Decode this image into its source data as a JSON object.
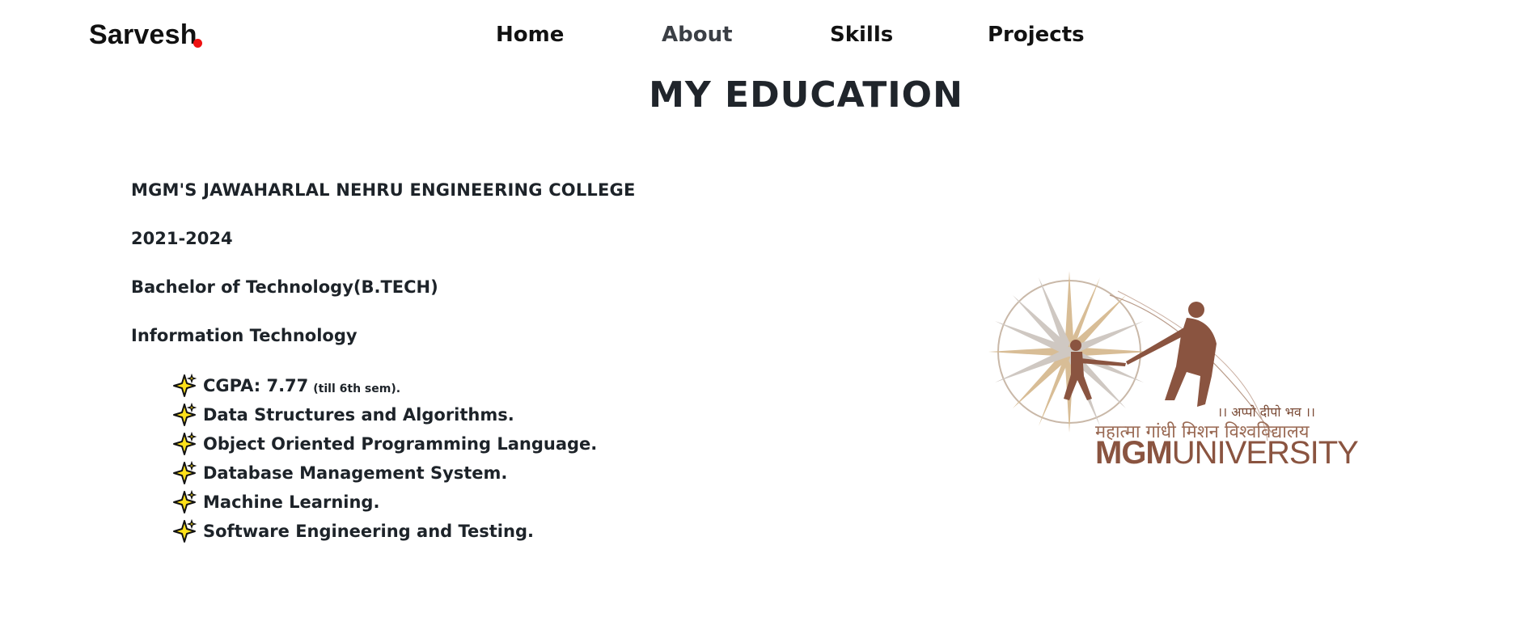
{
  "nav": {
    "brand": "Sarvesh",
    "links": [
      "Home",
      "About",
      "Skills",
      "Projects"
    ]
  },
  "section": {
    "title": "My Education"
  },
  "education": {
    "college": "MGM'S JAWAHARLAL NEHRU ENGINEERING COLLEGE",
    "years": "2021-2024",
    "degree": "Bachelor of Technology(B.TECH)",
    "branch": "Information Technology",
    "cgpa_label": "CGPA: 7.77",
    "cgpa_note": "(till 6th sem).",
    "subjects": [
      "Data Structures and Algorithms.",
      "Object Oriented Programming Language.",
      "Database Management System.",
      "Machine Learning.",
      "Software Engineering and Testing."
    ]
  },
  "logo": {
    "motto": "।। अप्पो दीपो भव ।।",
    "hindi_name": "महात्मा गांधी मिशन विश्वविद्यालय",
    "word_bold": "MGM",
    "word_light": "UNIVERSITY"
  },
  "colors": {
    "brand_dot": "#ee1111",
    "logo_brown": "#8a5440",
    "sparkle_fill": "#ffe11a"
  },
  "icons": {
    "bullet": "sparkle-icon"
  }
}
